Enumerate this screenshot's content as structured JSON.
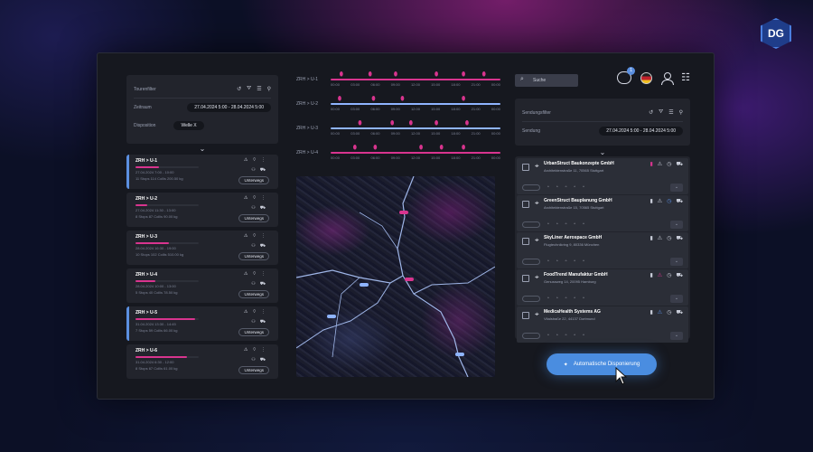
{
  "brand": "DG",
  "left": {
    "filter_title": "Tourenfilter",
    "zeitraum_label": "Zeitraum",
    "zeitraum_value": "27.04.2024 5:00 - 28.04.2024 5:00",
    "disposition_label": "Disposition",
    "disposition_value": "Welle X",
    "tours": [
      {
        "title": "ZRH > U-1",
        "date": "27.04.2024",
        "time": "7:00 - 10:00",
        "stops": "11 Stops",
        "colli": "114 Collis",
        "weight": "200.50 kg",
        "status": "Unterwegs",
        "progress": 0.6
      },
      {
        "title": "ZRH > U-2",
        "date": "27.04.2024",
        "time": "11:30 - 13:00",
        "stops": "8 Stops",
        "colli": "87 Collis",
        "weight": "90.00 kg",
        "status": "Unterwegs",
        "progress": 0.3
      },
      {
        "title": "ZRH > U-3",
        "date": "28.04.2024",
        "time": "16:30 - 19:00",
        "stops": "10 Stops",
        "colli": "102 Collis",
        "weight": "510.00 kg",
        "status": "Unterwegs",
        "progress": 0.85
      },
      {
        "title": "ZRH > U-4",
        "date": "28.04.2024",
        "time": "10:00 - 13:00",
        "stops": "5 Stops",
        "colli": "40 Collis",
        "weight": "78.50 kg",
        "status": "Unterwegs",
        "progress": 0.5
      },
      {
        "title": "ZRH > U-5",
        "date": "31.04.2024",
        "time": "13:30 - 14:45",
        "stops": "7 Stops",
        "colli": "59 Collis",
        "weight": "66.00 kg",
        "status": "Unterwegs",
        "progress": 1.5
      },
      {
        "title": "ZRH > U-6",
        "date": "31.04.2024",
        "time": "6:30 - 12:00",
        "stops": "8 Stops",
        "colli": "67 Collis",
        "weight": "61.00 kg",
        "status": "Unterwegs",
        "progress": 1.3
      }
    ]
  },
  "timeline": {
    "rows": [
      {
        "label": "ZRH > U-1",
        "color": "#d8348e",
        "pins": [
          0.06,
          0.23,
          0.38,
          0.62,
          0.78,
          0.9
        ]
      },
      {
        "label": "ZRH > U-2",
        "color": "#8fb4ff",
        "pins": [
          0.05,
          0.25,
          0.42,
          0.78
        ]
      },
      {
        "label": "ZRH > U-3",
        "color": "#8fb4ff",
        "pins": [
          0.17,
          0.36,
          0.47,
          0.62,
          0.8
        ]
      },
      {
        "label": "ZRH > U-4",
        "color": "#d8348e",
        "pins": [
          0.14,
          0.26,
          0.53,
          0.65,
          0.78
        ]
      }
    ],
    "times": [
      "00:00",
      "03:00",
      "06:00",
      "09:00",
      "12:00",
      "15:00",
      "18:00",
      "21:00",
      "00:00"
    ]
  },
  "right": {
    "search_placeholder": "Suche",
    "chat_count": "1",
    "filter_title": "Sendungsfilter",
    "sendung_label": "Sendung",
    "sendung_value": "27.04.2024 5:00 - 28.04.2024 5:00",
    "shipments": [
      {
        "name": "UrbanStruct Baukonzepte GmbH",
        "address": "Architektenstraße 11, 70565 Stuttgart",
        "warn_color": "#c9cdd9",
        "clock_color": "#c9cdd9",
        "mark_color": "#d8348e"
      },
      {
        "name": "GreenStruct Bauplanung GmbH",
        "address": "Architektenstraße 15, 70565 Stuttgart",
        "warn_color": "#c9cdd9",
        "clock_color": "#5b8fe0",
        "mark_color": "#c9cdd9"
      },
      {
        "name": "SkyLiner Aerospace GmbH",
        "address": "Flugtechnikring 9, 80336 München",
        "warn_color": "#c9cdd9",
        "clock_color": "#c9cdd9",
        "mark_color": "#c9cdd9"
      },
      {
        "name": "FoodTrend Manufaktur GmbH",
        "address": "Genussweg 14, 20095 Hamburg",
        "warn_color": "#d8348e",
        "clock_color": "#c9cdd9",
        "mark_color": "#c9cdd9"
      },
      {
        "name": "MedicaHealth Systems AG",
        "address": "Vitalstraße 22, 44137 Dortmund",
        "warn_color": "#5b8fe0",
        "clock_color": "#c9cdd9",
        "mark_color": "#c9cdd9"
      }
    ],
    "auto_button": "Automatische Disponierung"
  }
}
